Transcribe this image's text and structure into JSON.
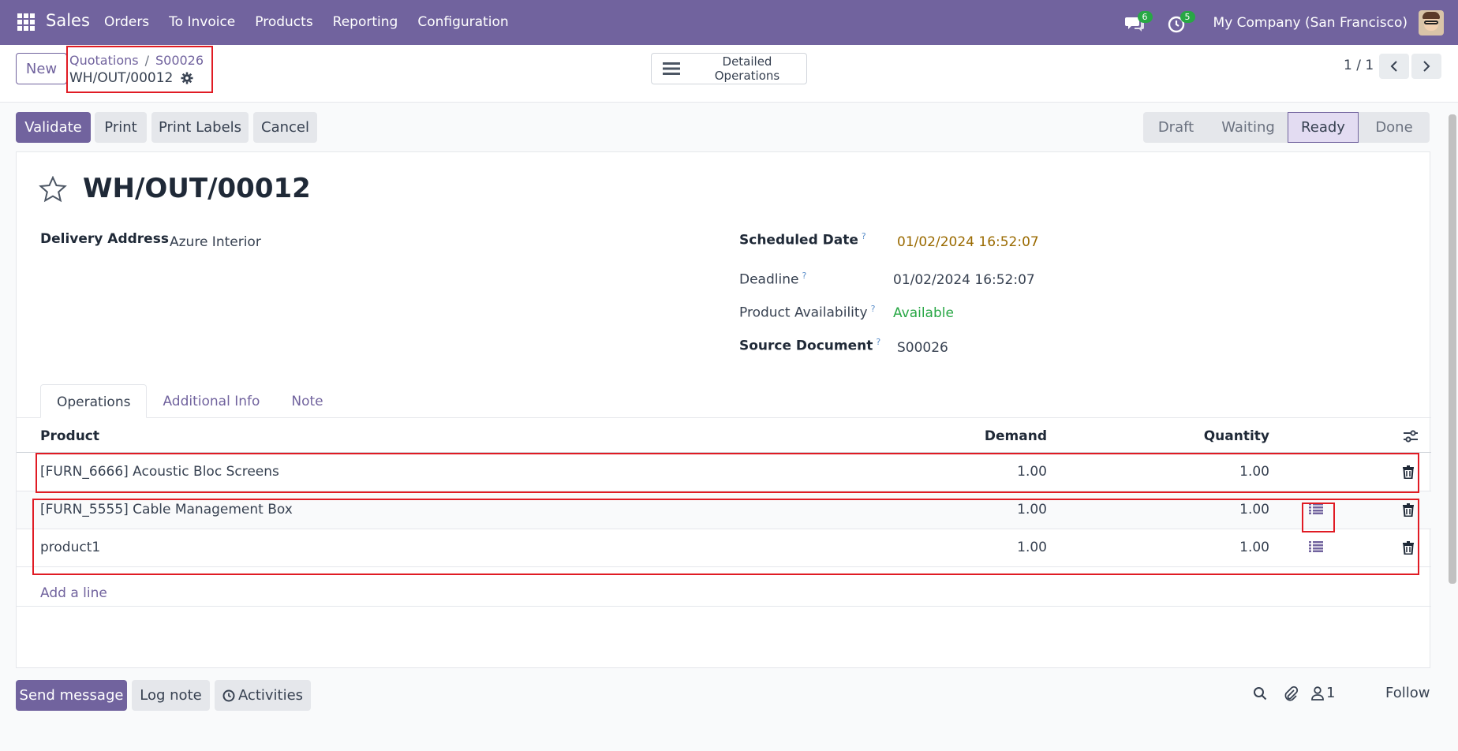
{
  "navbar": {
    "app_name": "Sales",
    "menu": [
      "Orders",
      "To Invoice",
      "Products",
      "Reporting",
      "Configuration"
    ],
    "messages_count": "6",
    "activities_count": "5",
    "company": "My Company (San Francisco)"
  },
  "control_panel": {
    "new_label": "New",
    "breadcrumb": [
      "Quotations",
      "S00026"
    ],
    "record_name": "WH/OUT/00012",
    "detailed_operations_label": "Detailed Operations",
    "pager": "1 / 1"
  },
  "actions": {
    "validate": "Validate",
    "print": "Print",
    "print_labels": "Print Labels",
    "cancel": "Cancel"
  },
  "status": {
    "stages": [
      "Draft",
      "Waiting",
      "Ready",
      "Done"
    ],
    "current": "Ready"
  },
  "form": {
    "title": "WH/OUT/00012",
    "delivery_address_label": "Delivery Address",
    "delivery_address": "Azure Interior",
    "scheduled_date_label": "Scheduled Date",
    "scheduled_date": "01/02/2024 16:52:07",
    "deadline_label": "Deadline",
    "deadline": "01/02/2024 16:52:07",
    "availability_label": "Product Availability",
    "availability": "Available",
    "source_document_label": "Source Document",
    "source_document": "S00026",
    "help_mark": "?"
  },
  "tabs": [
    "Operations",
    "Additional Info",
    "Note"
  ],
  "table": {
    "headers": {
      "product": "Product",
      "demand": "Demand",
      "quantity": "Quantity"
    },
    "rows": [
      {
        "product": "[FURN_6666] Acoustic Bloc Screens",
        "demand": "1.00",
        "quantity": "1.00",
        "detail_icon": false
      },
      {
        "product": "[FURN_5555] Cable Management Box",
        "demand": "1.00",
        "quantity": "1.00",
        "detail_icon": true
      },
      {
        "product": "product1",
        "demand": "1.00",
        "quantity": "1.00",
        "detail_icon": true
      }
    ],
    "add_line": "Add a line"
  },
  "chatter": {
    "send_message": "Send message",
    "log_note": "Log note",
    "activities": "Activities",
    "followers_count": "1",
    "follow": "Follow"
  },
  "colors": {
    "brand": "#71639e",
    "highlight": "#e01b24",
    "available": "#28a745",
    "warning_date": "#9a6a00"
  }
}
